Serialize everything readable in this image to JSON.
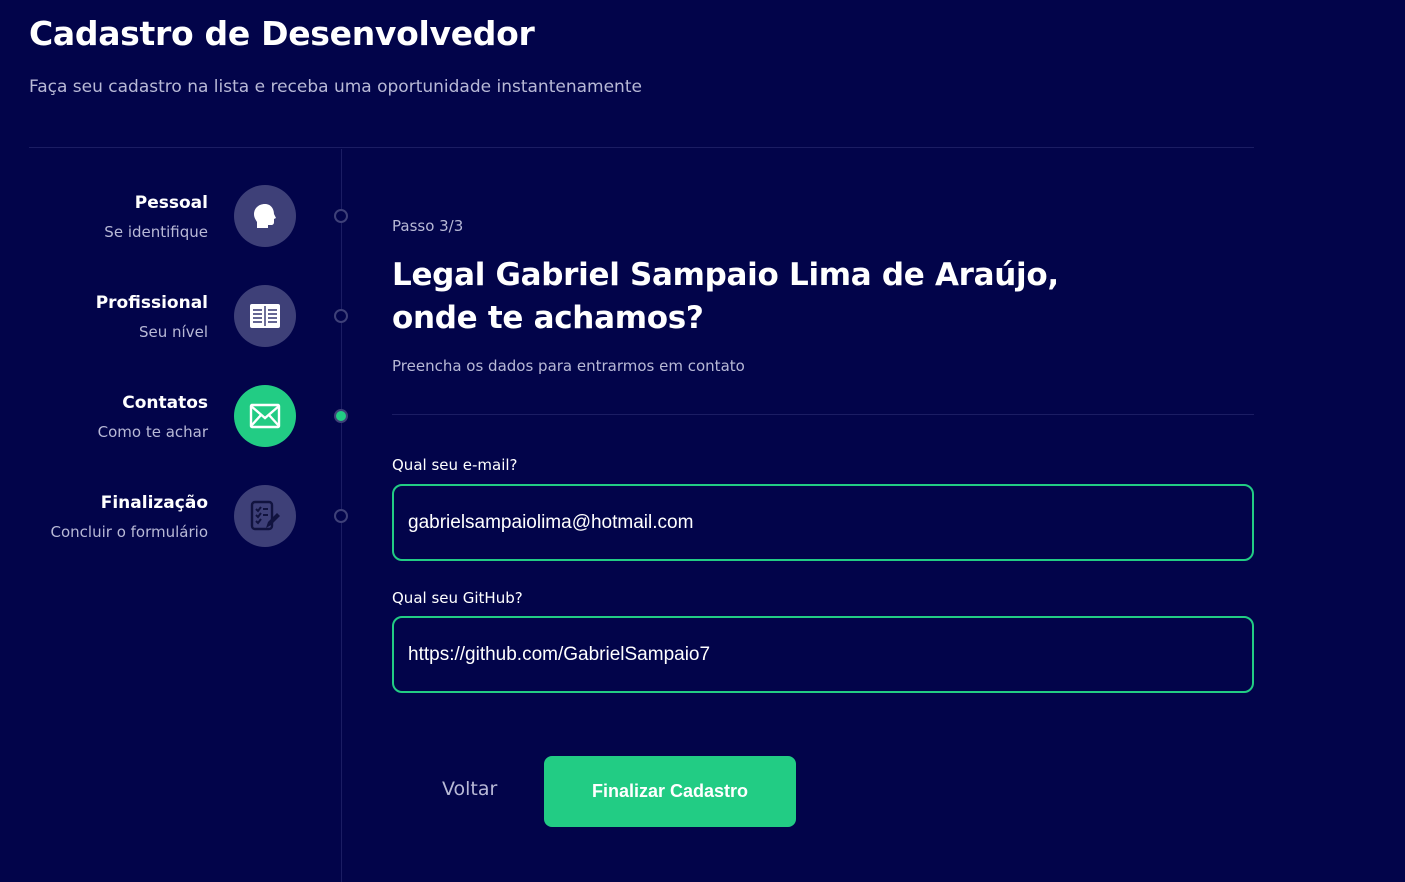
{
  "header": {
    "title": "Cadastro de Desenvolvedor",
    "subtitle": "Faça seu cadastro na lista e receba uma oportunidade instantenamente"
  },
  "steps": [
    {
      "title": "Pessoal",
      "desc": "Se identifique",
      "icon": "user-head-icon",
      "active": false
    },
    {
      "title": "Profissional",
      "desc": "Seu nível",
      "icon": "book-icon",
      "active": false
    },
    {
      "title": "Contatos",
      "desc": "Como te achar",
      "icon": "mail-icon",
      "active": true
    },
    {
      "title": "Finalização",
      "desc": "Concluir o formulário",
      "icon": "checklist-icon",
      "active": false
    }
  ],
  "form": {
    "step_label": "Passo 3/3",
    "title": "Legal Gabriel Sampaio Lima de Araújo, onde te achamos?",
    "subtitle": "Preencha os dados para entrarmos em contato",
    "email_label": "Qual seu e-mail?",
    "email_value": "gabrielsampaiolima@hotmail.com",
    "github_label": "Qual seu GitHub?",
    "github_value": "https://github.com/GabrielSampaio7",
    "back_label": "Voltar",
    "finish_label": "Finalizar Cadastro"
  },
  "colors": {
    "background": "#02044a",
    "accent": "#22cc84",
    "muted_icon": "#3e4078",
    "muted_text": "#b8b9d6"
  }
}
